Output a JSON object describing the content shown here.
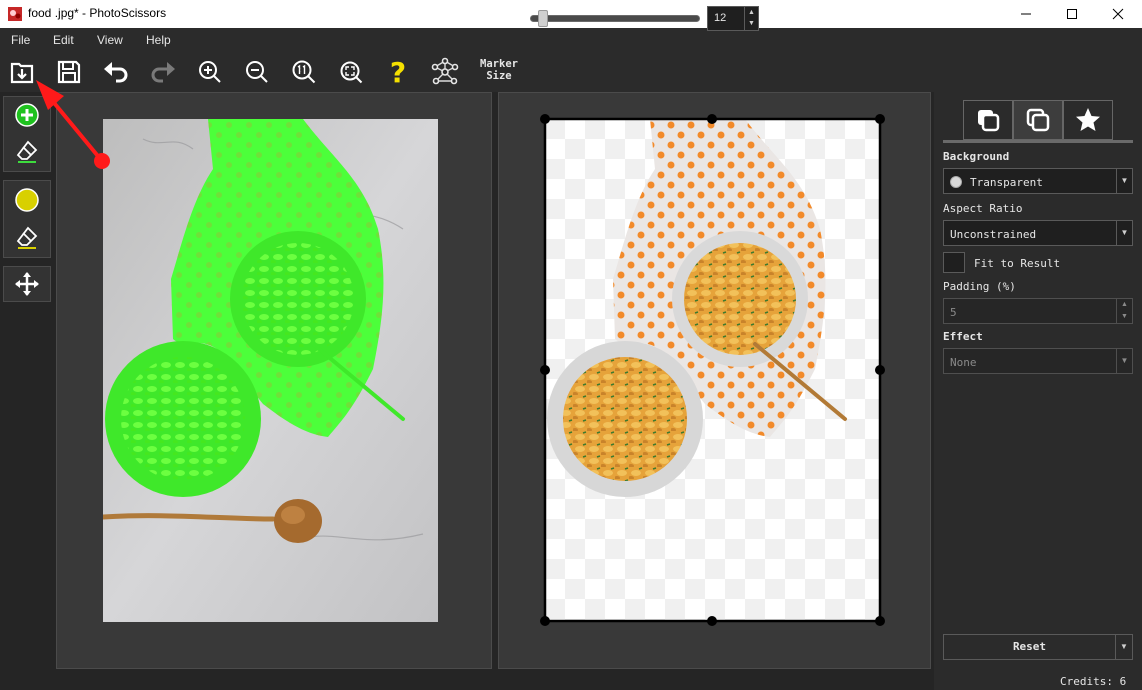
{
  "window": {
    "title": "food .jpg* - PhotoScissors",
    "icon": "photoscissors-app-icon",
    "controls": [
      "minimize-icon",
      "maximize-icon",
      "close-icon"
    ]
  },
  "menu": [
    "File",
    "Edit",
    "View",
    "Help"
  ],
  "toolbar": {
    "buttons": [
      "open-icon",
      "save-icon",
      "undo-icon",
      "redo-icon",
      "zoom-in-icon",
      "zoom-out-icon",
      "zoom-actual-icon",
      "zoom-fit-icon",
      "help-icon",
      "network-icon"
    ],
    "marker_label_line1": "Marker",
    "marker_label_line2": "Size",
    "marker_value": "12",
    "marker_level": 0.05
  },
  "tools": [
    "foreground-marker-icon",
    "foreground-eraser-icon",
    "background-marker-icon",
    "background-eraser-icon",
    "move-icon"
  ],
  "settings": {
    "tabs": [
      "copy-icon",
      "layers-icon",
      "star-icon"
    ],
    "background_label": "Background",
    "background_value": "Transparent",
    "aspect_label": "Aspect Ratio",
    "aspect_value": "Unconstrained",
    "fit_label": "Fit to Result",
    "padding_label": "Padding (%)",
    "padding_value": "5",
    "effect_label": "Effect",
    "effect_value": "None",
    "reset_label": "Reset",
    "credits": "Credits: 6"
  },
  "colors": {
    "foreground_marker": "#4cff3a",
    "background_marker": "#d8d000",
    "annotation": "#ff1a1a",
    "dark_bg": "#252525",
    "panel_bg": "#393939"
  }
}
